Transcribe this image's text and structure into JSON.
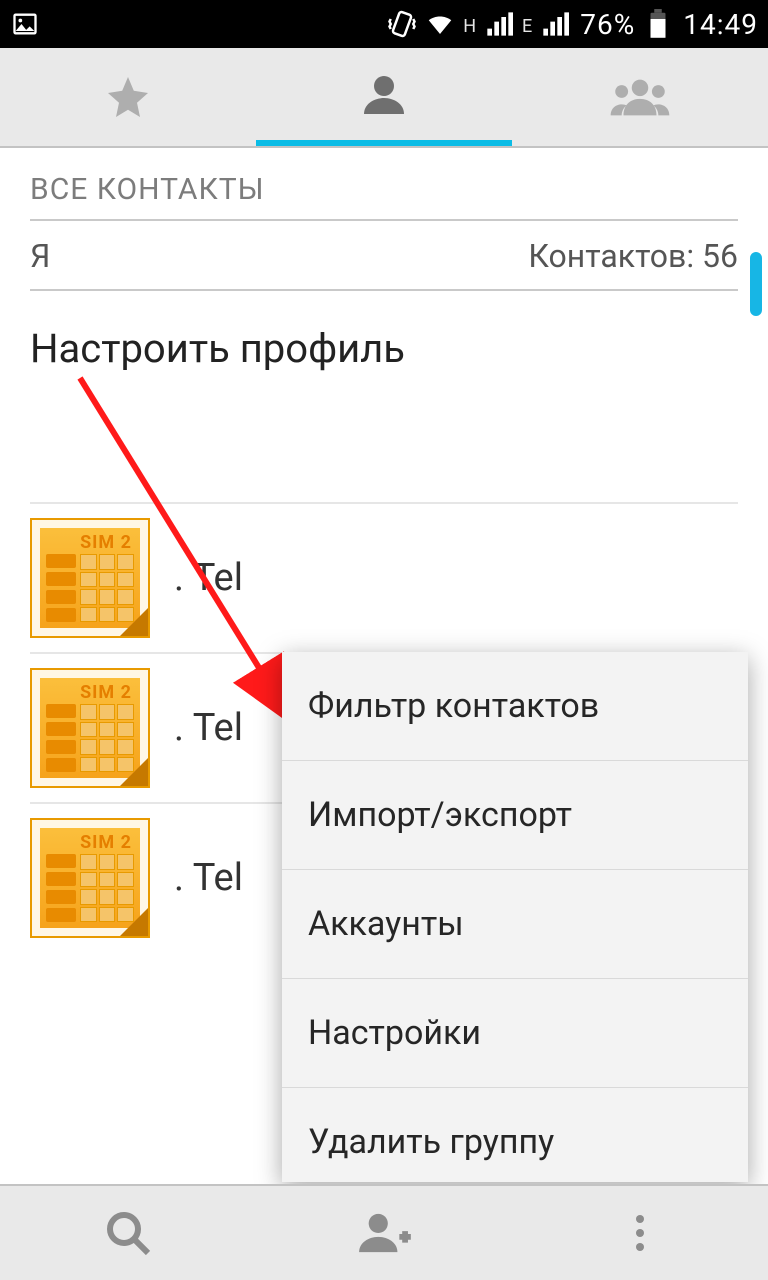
{
  "statusbar": {
    "battery_pct": "76%",
    "time": "14:49",
    "net1_sub": "H",
    "net2_sub": "E"
  },
  "header": {
    "title": "ВСЕ КОНТАКТЫ"
  },
  "me": {
    "label": "Я",
    "count_label": "Контактов: 56"
  },
  "profile": {
    "setup_label": "Настроить профиль"
  },
  "contacts": [
    {
      "sim": "SIM 2",
      "name": ". Tel"
    },
    {
      "sim": "SIM 2",
      "name": ". Tel"
    },
    {
      "sim": "SIM 2",
      "name": ". Tel"
    }
  ],
  "menu": {
    "items": [
      "Фильтр контактов",
      "Импорт/экспорт",
      "Аккаунты",
      "Настройки",
      "Удалить группу"
    ]
  }
}
